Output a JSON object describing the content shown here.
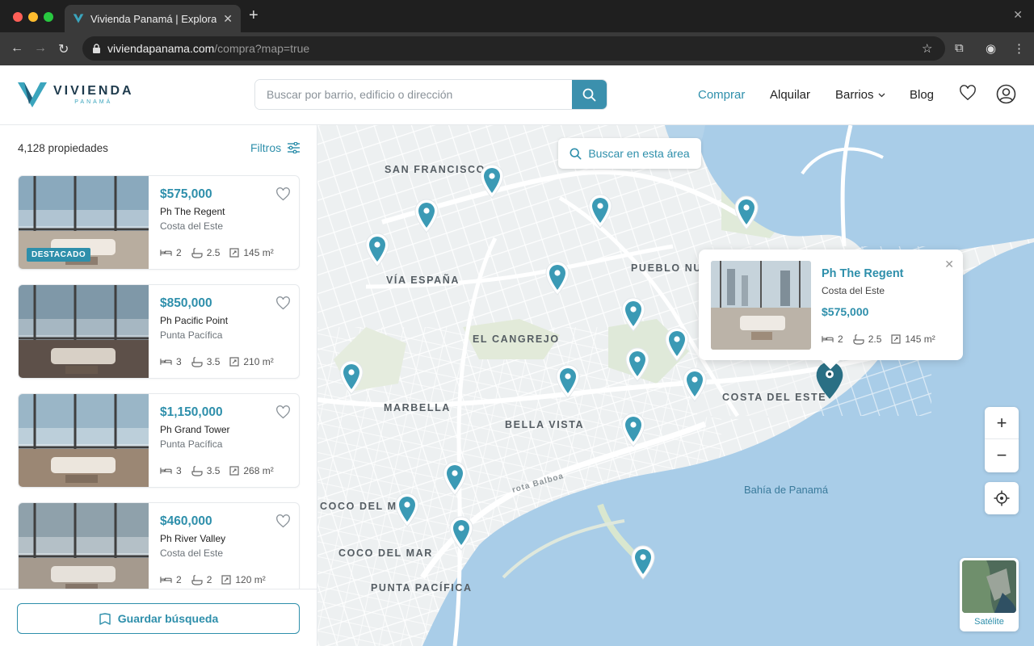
{
  "browser": {
    "tab_title": "Vivienda Panamá | Explora barrios",
    "url_host": "viviendapanama.com",
    "url_path": "/compra?map=true"
  },
  "header": {
    "logo_main": "VIVIENDA",
    "logo_sub": "PANAMÁ",
    "search_placeholder": "Buscar por barrio, edificio o dirección",
    "nav": {
      "buy": "Comprar",
      "rent": "Alquilar",
      "neighborhoods": "Barrios",
      "blog": "Blog"
    }
  },
  "sidebar": {
    "count": "4,128 propiedades",
    "filters_label": "Filtros",
    "save_search": "Guardar búsqueda",
    "listings": [
      {
        "price": "$575,000",
        "name": "Ph The Regent",
        "area": "Costa del Este",
        "beds": "2",
        "baths": "2.5",
        "size": "145 m²",
        "badge": "DESTACADO"
      },
      {
        "price": "$850,000",
        "name": "Ph Pacific Point",
        "area": "Punta Pacífica",
        "beds": "3",
        "baths": "3.5",
        "size": "210 m²"
      },
      {
        "price": "$1,150,000",
        "name": "Ph Grand Tower",
        "area": "Punta Pacífica",
        "beds": "3",
        "baths": "3.5",
        "size": "268 m²"
      },
      {
        "price": "$460,000",
        "name": "Ph River Valley",
        "area": "Costa del Este",
        "beds": "2",
        "baths": "2",
        "size": "120 m²"
      }
    ]
  },
  "map": {
    "search_area_label": "Buscar en esta área",
    "labels": {
      "san_francisco": "SAN FRANCISCO",
      "via_espana": "VÍA ESPAÑA",
      "pueblo_nuevo": "PUEBLO NUE",
      "el_cangrejo": "EL CANGREJO",
      "marbella": "MARBELLA",
      "bella_vista": "BELLA VISTA",
      "costa_del_este": "COSTA DEL ESTE",
      "coco_del_mar_1": "COCO DEL MA",
      "coco_del_mar_2": "COCO DEL MAR",
      "punta_pacifica": "PUNTA PACÍFICA",
      "bahia": "Bahía de Panamá",
      "road_balboa": "rota Balboa"
    },
    "popup": {
      "title": "Ph The Regent",
      "area": "Costa del Este",
      "price": "$575,000",
      "beds": "2",
      "baths": "2.5",
      "size": "145 m²"
    },
    "zoom_in": "+",
    "zoom_out": "−",
    "satellite_label": "Satélite"
  },
  "colors": {
    "accent": "#2e8fab",
    "pin": "#3b9ab5",
    "pin_selected": "#2a6f84"
  }
}
